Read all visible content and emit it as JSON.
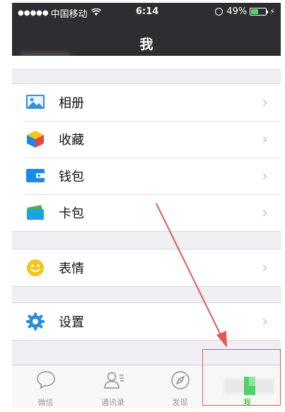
{
  "statusbar": {
    "signal_dots": "●●●●●",
    "carrier": "中国移动",
    "time": "6:14",
    "battery_percent": "49%",
    "battery_level": 0.49
  },
  "header": {
    "title": "我"
  },
  "menu": {
    "group1": [
      {
        "label": "相册",
        "icon": "photo-album-icon",
        "color": "#2f8fe0"
      },
      {
        "label": "收藏",
        "icon": "favorites-cube-icon",
        "color": "#f2a51a"
      },
      {
        "label": "钱包",
        "icon": "wallet-icon",
        "color": "#1a8ae6"
      },
      {
        "label": "卡包",
        "icon": "card-package-icon",
        "color": "#1aa3e0"
      }
    ],
    "group2": [
      {
        "label": "表情",
        "icon": "smiley-icon",
        "color": "#f5c518"
      }
    ],
    "group3": [
      {
        "label": "设置",
        "icon": "settings-gear-icon",
        "color": "#2a8cdc"
      }
    ],
    "chevron": "›"
  },
  "tabbar": {
    "tabs": [
      {
        "label": "微信",
        "icon": "chat-bubble-icon"
      },
      {
        "label": "通讯录",
        "icon": "contacts-icon"
      },
      {
        "label": "发现",
        "icon": "compass-icon"
      },
      {
        "label": "我",
        "icon": "me-icon",
        "active": true
      }
    ],
    "active_color": "#1aad19"
  },
  "annotation": {
    "color": "#e15a5a"
  }
}
